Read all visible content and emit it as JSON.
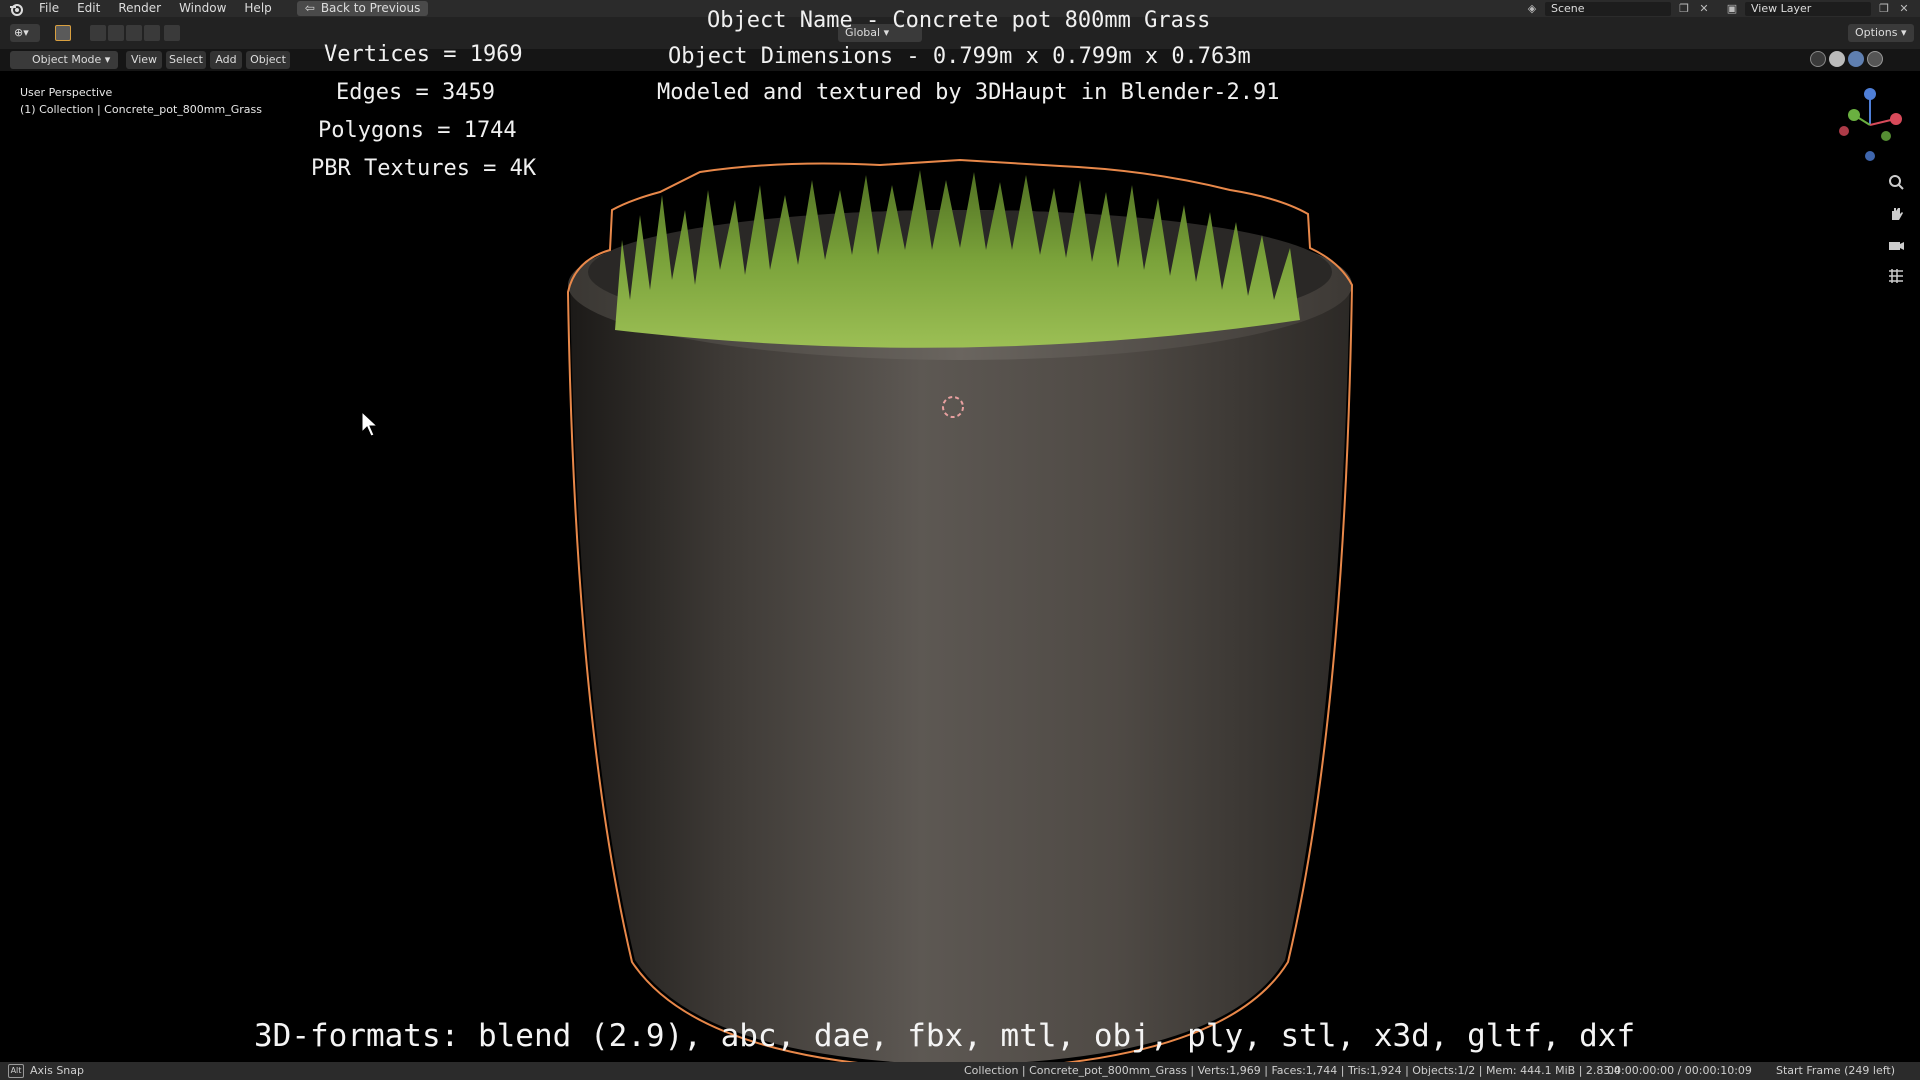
{
  "menu": {
    "items": [
      "File",
      "Edit",
      "Render",
      "Window",
      "Help"
    ],
    "back_label": "Back to Previous"
  },
  "title_overlay": {
    "object_name": "Object Name - Concrete pot 800mm Grass",
    "dimensions": "Object Dimensions -  0.799m x 0.799m x 0.763m",
    "credit": "Modeled and textured by 3DHaupt in Blender-2.91"
  },
  "stats": {
    "vertices": "Vertices = 1969",
    "edges": "Edges = 3459",
    "polygons": "Polygons = 1744",
    "textures": "PBR Textures = 4K"
  },
  "scene": {
    "label": "Scene"
  },
  "view_layer": {
    "label": "View Layer"
  },
  "options": {
    "label": "Options"
  },
  "transform": {
    "orientation": "Global"
  },
  "header": {
    "mode": "Object Mode",
    "view": "View",
    "select": "Select",
    "add": "Add",
    "object": "Object"
  },
  "viewport": {
    "perspective": "User Perspective",
    "collection": "(1) Collection | Concrete_pot_800mm_Grass"
  },
  "formats": "3D-formats: blend (2.9), abc, dae, fbx, mtl, obj, ply, stl, x3d, gltf, dxf",
  "statusbar": {
    "left": "Axis Snap",
    "info": "Collection | Concrete_pot_800mm_Grass | Verts:1,969 | Faces:1,744 | Tris:1,924 | Objects:1/2 | Mem: 444.1 MiB | 2.83.4",
    "time": "00:00:00:00 / 00:00:10:09",
    "frame": "Start Frame (249 left)"
  },
  "colors": {
    "outline": "#e8884a",
    "grass": "#6f9a35",
    "concrete": "#5a5550"
  },
  "icons": [
    "blender-logo-icon",
    "zoom-icon",
    "hand-icon",
    "camera-icon",
    "grid-icon"
  ]
}
